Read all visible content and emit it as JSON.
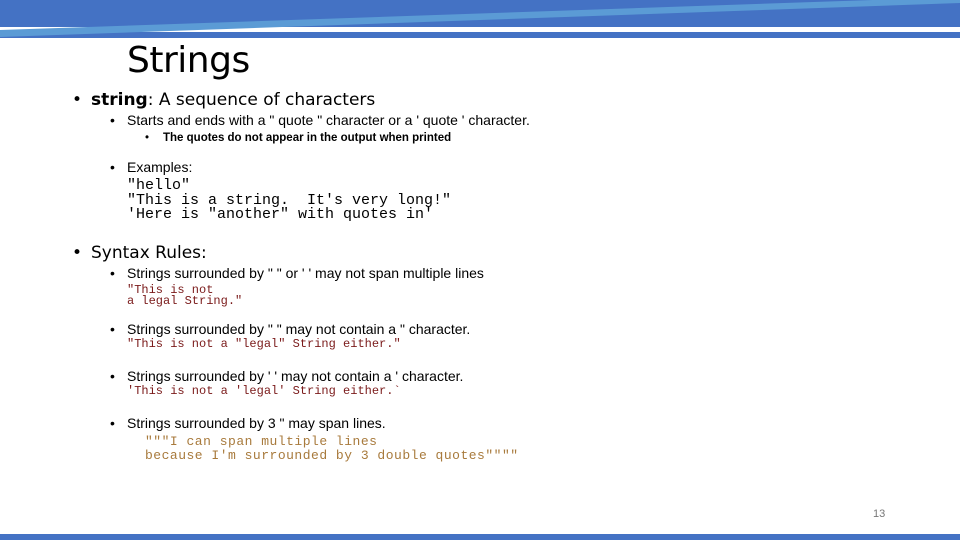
{
  "colors": {
    "header_dark": "#4472C4",
    "header_light": "#5B9BD5",
    "code_red": "#7a1a1a",
    "code_tan": "#a87a3c",
    "page_number": "#777777"
  },
  "slide": {
    "title": "Strings",
    "page_number": "13",
    "definition": {
      "term": "string",
      "rest": ": A sequence of characters",
      "sub": "Starts and ends with a \" quote \" character or a ' quote ' character.",
      "subsub": "The quotes do not appear in the output when printed"
    },
    "examples": {
      "label": "Examples:",
      "lines": [
        "\"hello\"",
        "\"This is a string.  It's very long!\"",
        "'Here is \"another\" with quotes in'"
      ]
    },
    "syntax": {
      "label": "Syntax Rules:",
      "rules": [
        {
          "text": "Strings surrounded by \" \" or ' ' may not span multiple lines",
          "code": "\"This is not\na legal String.\""
        },
        {
          "text": "Strings surrounded by \" \" may not contain a \" character.",
          "code": "\"This is not a \"legal\" String either.\""
        },
        {
          "text": "Strings surrounded by ' ' may not contain a ' character.",
          "code": "'This is not a 'legal' String either.`"
        },
        {
          "text": "Strings surrounded by  3  \"  may span lines.",
          "code": "\"\"\"I can span multiple lines\nbecause I'm surrounded by 3 double quotes\"\"\"\""
        }
      ]
    },
    "bullet_glyph": "•"
  }
}
